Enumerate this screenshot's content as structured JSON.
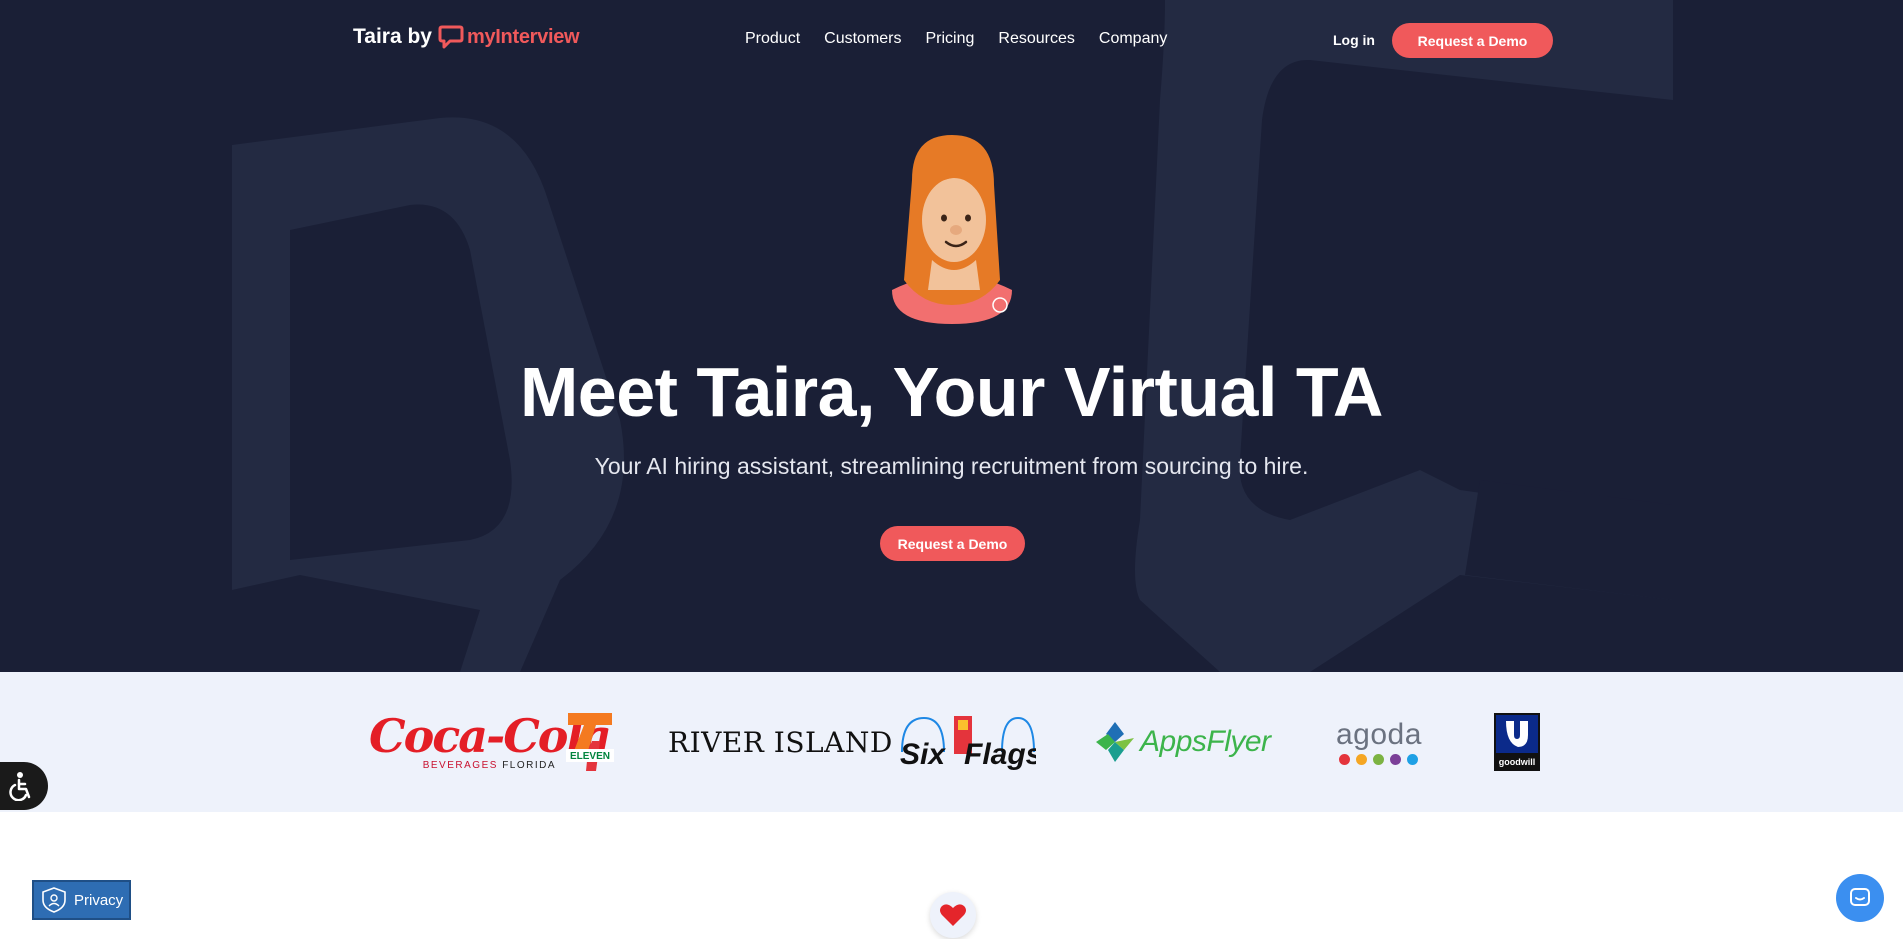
{
  "nav": {
    "logo_prefix": "Taira by",
    "logo_brand": "myInterview",
    "menu": [
      {
        "label": "Product"
      },
      {
        "label": "Customers"
      },
      {
        "label": "Pricing"
      },
      {
        "label": "Resources"
      },
      {
        "label": "Company"
      }
    ],
    "login_label": "Log in",
    "demo_label": "Request a Demo"
  },
  "hero": {
    "headline": "Meet Taira, Your Virtual TA",
    "subhead": "Your AI hiring assistant, streamlining recruitment from sourcing to hire.",
    "cta_label": "Request a Demo"
  },
  "customers": {
    "coca_cola": {
      "script": "Coca-Cola",
      "sub_red": "BEVERAGES",
      "sub_dark": "FLORIDA"
    },
    "seven_eleven": {
      "text": "ELEVEN"
    },
    "river_island": "RIVER ISLAND",
    "six_flags": {
      "six": "Six",
      "flags": "Flags"
    },
    "appsflyer": "AppsFlyer",
    "agoda": {
      "word": "agoda",
      "dot_colors": [
        "#e4343c",
        "#f5a623",
        "#7cb342",
        "#7b3f98",
        "#1ea0e5"
      ]
    },
    "goodwill": {
      "text": "goodwill"
    }
  },
  "widgets": {
    "privacy_label": "Privacy"
  },
  "colors": {
    "hero_bg": "#1a1f36",
    "accent": "#f0595b",
    "strip_bg": "#eef2fb",
    "privacy_bg": "#2e6db3",
    "chat_bg": "#3b8ff0"
  },
  "icons": [
    "accessibility-icon",
    "privacy-shield-icon",
    "heart-icon",
    "chat-icon",
    "speech-bubble-logo-icon"
  ]
}
